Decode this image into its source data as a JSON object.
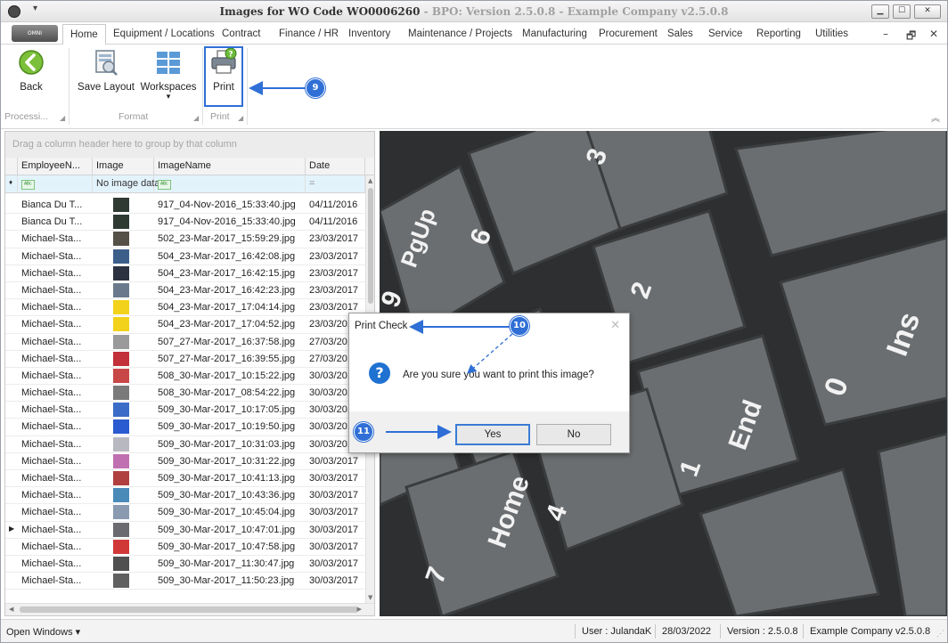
{
  "window": {
    "title_main": "Images for WO Code WO0006260",
    "title_sub": "- BPO: Version 2.5.0.8 - Example Company v2.5.0.8",
    "qat_glyph": "▾",
    "min_glyph": "▁",
    "max_glyph": "☐",
    "close_glyph": "✕"
  },
  "app_button": {
    "label": "OMNI"
  },
  "tabs": [
    "Home",
    "Equipment / Locations",
    "Contract",
    "Finance / HR",
    "Inventory",
    "Maintenance / Projects",
    "Manufacturing",
    "Procurement",
    "Sales",
    "Service",
    "Reporting",
    "Utilities"
  ],
  "mdi": {
    "minimize": "–",
    "restore": "🗗",
    "close": "✕"
  },
  "ribbon": {
    "back": "Back",
    "save_layout": "Save Layout",
    "workspaces": "Workspaces",
    "workspaces_arrow": "▾",
    "print": "Print",
    "groups": [
      "Processi...",
      "Format",
      "Print"
    ],
    "collapse_glyph": "︽"
  },
  "callouts": {
    "c9": "9",
    "c10": "10",
    "c11": "11"
  },
  "grid": {
    "group_hint": "Drag a column header here to group by that column",
    "columns": [
      "EmployeeN...",
      "Image",
      "ImageName",
      "Date"
    ],
    "filter": {
      "pin": "♦",
      "image": "No image data",
      "date": "="
    },
    "filter_icon": "ᴬᴮᶜ",
    "current_row_marker": "▶",
    "rows": [
      {
        "emp": "Bianca Du T...",
        "name": "917_04-Nov-2016_15:33:40.jpg",
        "date": "04/11/2016",
        "thumb": "#2f3a33"
      },
      {
        "emp": "Bianca Du T...",
        "name": "917_04-Nov-2016_15:33:40.jpg",
        "date": "04/11/2016",
        "thumb": "#2f3a33"
      },
      {
        "emp": "Michael-Sta...",
        "name": "502_23-Mar-2017_15:59:29.jpg",
        "date": "23/03/2017",
        "thumb": "#555048"
      },
      {
        "emp": "Michael-Sta...",
        "name": "504_23-Mar-2017_16:42:08.jpg",
        "date": "23/03/2017",
        "thumb": "#3c5f8a"
      },
      {
        "emp": "Michael-Sta...",
        "name": "504_23-Mar-2017_16:42:15.jpg",
        "date": "23/03/2017",
        "thumb": "#2c3240"
      },
      {
        "emp": "Michael-Sta...",
        "name": "504_23-Mar-2017_16:42:23.jpg",
        "date": "23/03/2017",
        "thumb": "#6a7a8c"
      },
      {
        "emp": "Michael-Sta...",
        "name": "504_23-Mar-2017_17:04:14.jpg",
        "date": "23/03/2017",
        "thumb": "#f2d21a"
      },
      {
        "emp": "Michael-Sta...",
        "name": "504_23-Mar-2017_17:04:52.jpg",
        "date": "23/03/2017",
        "thumb": "#f2d21a"
      },
      {
        "emp": "Michael-Sta...",
        "name": "507_27-Mar-2017_16:37:58.jpg",
        "date": "27/03/2017",
        "thumb": "#9a9a9a"
      },
      {
        "emp": "Michael-Sta...",
        "name": "507_27-Mar-2017_16:39:55.jpg",
        "date": "27/03/2017",
        "thumb": "#c2303a"
      },
      {
        "emp": "Michael-Sta...",
        "name": "508_30-Mar-2017_10:15:22.jpg",
        "date": "30/03/2017",
        "thumb": "#c84848"
      },
      {
        "emp": "Michael-Sta...",
        "name": "508_30-Mar-2017_08:54:22.jpg",
        "date": "30/03/2017",
        "thumb": "#7a7a7a"
      },
      {
        "emp": "Michael-Sta...",
        "name": "509_30-Mar-2017_10:17:05.jpg",
        "date": "30/03/2017",
        "thumb": "#3a6cc8"
      },
      {
        "emp": "Michael-Sta...",
        "name": "509_30-Mar-2017_10:19:50.jpg",
        "date": "30/03/2017",
        "thumb": "#2a5bd0"
      },
      {
        "emp": "Michael-Sta...",
        "name": "509_30-Mar-2017_10:31:03.jpg",
        "date": "30/03/2017",
        "thumb": "#b8b8c0"
      },
      {
        "emp": "Michael-Sta...",
        "name": "509_30-Mar-2017_10:31:22.jpg",
        "date": "30/03/2017",
        "thumb": "#c070b0"
      },
      {
        "emp": "Michael-Sta...",
        "name": "509_30-Mar-2017_10:41:13.jpg",
        "date": "30/03/2017",
        "thumb": "#b04040"
      },
      {
        "emp": "Michael-Sta...",
        "name": "509_30-Mar-2017_10:43:36.jpg",
        "date": "30/03/2017",
        "thumb": "#4a8ab8"
      },
      {
        "emp": "Michael-Sta...",
        "name": "509_30-Mar-2017_10:45:04.jpg",
        "date": "30/03/2017",
        "thumb": "#8a9ab0"
      },
      {
        "emp": "Michael-Sta...",
        "name": "509_30-Mar-2017_10:47:01.jpg",
        "date": "30/03/2017",
        "thumb": "#6a6a70",
        "current": true
      },
      {
        "emp": "Michael-Sta...",
        "name": "509_30-Mar-2017_10:47:58.jpg",
        "date": "30/03/2017",
        "thumb": "#d03838"
      },
      {
        "emp": "Michael-Sta...",
        "name": "509_30-Mar-2017_11:30:47.jpg",
        "date": "30/03/2017",
        "thumb": "#505050"
      },
      {
        "emp": "Michael-Sta...",
        "name": "509_30-Mar-2017_11:50:23.jpg",
        "date": "30/03/2017",
        "thumb": "#606060"
      }
    ]
  },
  "keys": {
    "pgup": "PgUp",
    "six": "6",
    "three": "3",
    "two": "2",
    "nine": "9",
    "ins": "Ins",
    "zero": "0",
    "end": "End",
    "one": "1",
    "home": "Home",
    "seven": "7",
    "four": "4"
  },
  "dialog": {
    "title": "Print Check",
    "close": "✕",
    "question_icon": "?",
    "message": "Are you sure you want to print this image?",
    "yes": "Yes",
    "no": "No"
  },
  "statusbar": {
    "open_windows": "Open Windows ▾",
    "user": "User : JulandaK",
    "date": "28/03/2022",
    "version": "Version : 2.5.0.8",
    "company": "Example Company v2.5.0.8",
    "grip": "⋰"
  },
  "colors": {
    "accent": "#2f6fd6",
    "dialog_icon": "#1f72d1",
    "filter_row": "#e3f3fc"
  },
  "icons": {
    "back": "back-arrow-icon",
    "save_layout": "save-layout-icon",
    "workspaces": "workspaces-icon",
    "print": "printer-icon",
    "question": "question-icon"
  }
}
